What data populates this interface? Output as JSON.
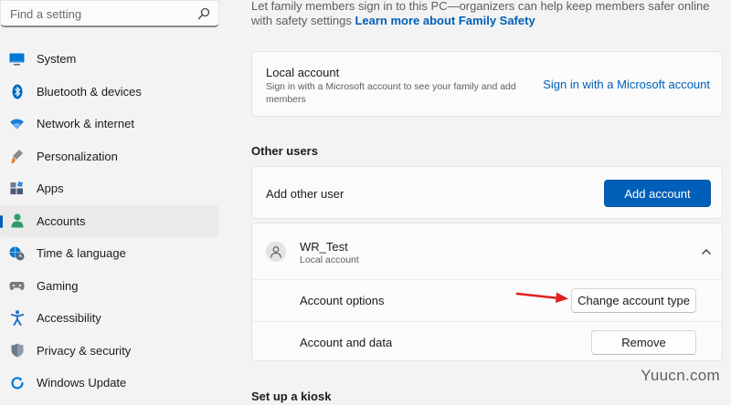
{
  "search": {
    "placeholder": "Find a setting"
  },
  "sidebar": {
    "items": [
      {
        "label": "System",
        "icon": "monitor-icon",
        "color": "#0078d4"
      },
      {
        "label": "Bluetooth & devices",
        "icon": "bluetooth-icon",
        "color": "#0067c0"
      },
      {
        "label": "Network & internet",
        "icon": "wifi-icon",
        "color": "#1a7ed4"
      },
      {
        "label": "Personalization",
        "icon": "paintbrush-icon",
        "color": "#e07b39"
      },
      {
        "label": "Apps",
        "icon": "apps-icon",
        "color": "#4a5b73"
      },
      {
        "label": "Accounts",
        "icon": "person-icon",
        "color": "#2e9d6b",
        "active": true
      },
      {
        "label": "Time & language",
        "icon": "globe-clock-icon",
        "color": "#0e75c7"
      },
      {
        "label": "Gaming",
        "icon": "gamepad-icon",
        "color": "#7a7a7a"
      },
      {
        "label": "Accessibility",
        "icon": "accessibility-icon",
        "color": "#1a6fd0"
      },
      {
        "label": "Privacy & security",
        "icon": "shield-icon",
        "color": "#6b7a8c"
      },
      {
        "label": "Windows Update",
        "icon": "update-icon",
        "color": "#0078d4"
      }
    ]
  },
  "main": {
    "intro_text": "Let family members sign in to this PC—organizers can help keep members safer online with safety settings",
    "intro_link": "Learn more about Family Safety",
    "local_account": {
      "title": "Local account",
      "description": "Sign in with a Microsoft account to see your family and add members",
      "link": "Sign in with a Microsoft account"
    },
    "other_users_title": "Other users",
    "add_other_user": {
      "label": "Add other user",
      "button": "Add account"
    },
    "user": {
      "name": "WR_Test",
      "type": "Local account",
      "account_options": {
        "label": "Account options",
        "button": "Change account type"
      },
      "account_data": {
        "label": "Account and data",
        "button": "Remove"
      }
    },
    "kiosk_title": "Set up a kiosk"
  },
  "watermark": "Yuucn.com",
  "colors": {
    "accent": "#005fb8",
    "arrow": "#e0201f"
  }
}
